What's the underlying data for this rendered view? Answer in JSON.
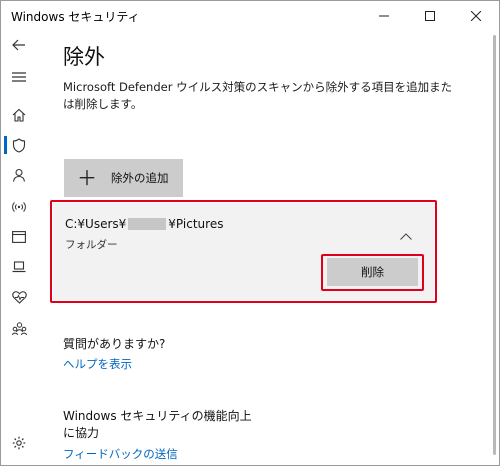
{
  "window": {
    "title": "Windows セキュリティ",
    "minimize_icon": "minimize-icon",
    "maximize_icon": "maximize-icon",
    "close_icon": "close-icon"
  },
  "sidebar": {
    "items": [
      {
        "name": "back",
        "icon": "back-arrow-icon"
      },
      {
        "name": "menu",
        "icon": "hamburger-icon"
      },
      {
        "name": "home",
        "icon": "home-icon"
      },
      {
        "name": "virus-protection",
        "icon": "shield-icon",
        "active": true
      },
      {
        "name": "account",
        "icon": "person-icon"
      },
      {
        "name": "firewall",
        "icon": "wifi-signal-icon"
      },
      {
        "name": "app-browser",
        "icon": "browser-window-icon"
      },
      {
        "name": "device-security",
        "icon": "laptop-icon"
      },
      {
        "name": "device-health",
        "icon": "heart-icon"
      },
      {
        "name": "family",
        "icon": "family-icon"
      },
      {
        "name": "settings",
        "icon": "gear-icon"
      }
    ]
  },
  "main": {
    "title": "除外",
    "description": "Microsoft Defender ウイルス対策のスキャンから除外する項目を追加または削除します。",
    "add_button": {
      "plus": "＋",
      "label": "除外の追加"
    },
    "exclusion": {
      "path_prefix": "C:¥Users¥",
      "path_suffix": "¥Pictures",
      "type": "フォルダー",
      "remove_label": "削除"
    },
    "questions": {
      "title": "質問がありますか?",
      "help_link": "ヘルプを表示"
    },
    "improve": {
      "title": "Windows セキュリティの機能向上に協力",
      "feedback_link": "フィードバックの送信"
    }
  },
  "colors": {
    "accent": "#0067c0",
    "highlight": "#e0001b",
    "button_bg": "#cccccc",
    "card_bg": "#f2f2f2"
  }
}
